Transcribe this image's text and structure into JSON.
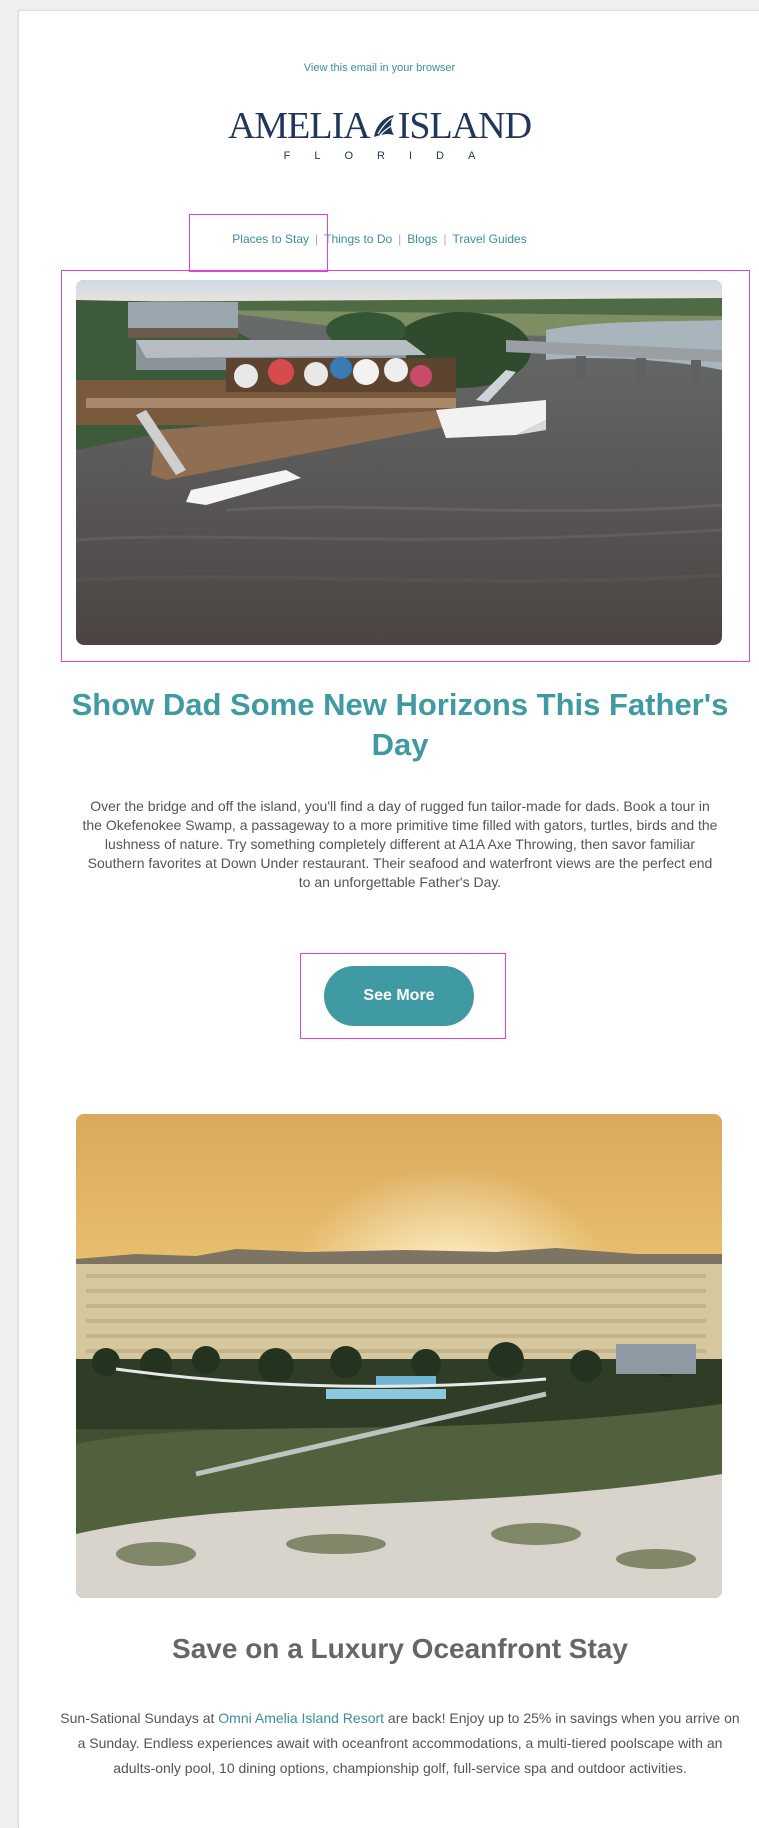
{
  "header": {
    "view_in_browser": "View this email in your browser",
    "logo_name_left": "AMELIA",
    "logo_name_right": "ISLAND",
    "logo_state": "FLORIDA"
  },
  "nav": {
    "items": [
      {
        "label": "Places to Stay"
      },
      {
        "label": "Things to Do"
      },
      {
        "label": "Blogs"
      },
      {
        "label": "Travel Guides"
      }
    ],
    "separator": "|"
  },
  "feature1": {
    "image_icon": "waterfront-restaurant-photo",
    "title": "Show Dad Some New Horizons This Father's Day",
    "body": "Over the bridge and off the island, you'll find a day of rugged fun tailor-made for dads. Book a tour in the Okefenokee Swamp, a passageway to a more primitive time filled with gators, turtles, birds and the lushness of nature. Try something completely different at A1A Axe Throwing, then savor familiar Southern favorites at Down Under restaurant. Their seafood and waterfront views are the perfect end to an unforgettable Father's Day.",
    "button_label": "See More"
  },
  "feature2": {
    "image_icon": "oceanfront-resort-photo",
    "title": "Save on a Luxury Oceanfront Stay",
    "body_prefix": "Sun-Sational Sundays at ",
    "body_link": "Omni Amelia Island Resort",
    "body_suffix": " are back! Enjoy up to 25% in savings when you arrive on a Sunday. Endless experiences await with oceanfront accommodations, a multi-tiered poolscape with an adults-only pool, 10 dining options, championship golf, full-service spa and outdoor activities."
  },
  "colors": {
    "accent": "#3f9aa3",
    "logo": "#20375c",
    "annotation": "#e040e0"
  }
}
